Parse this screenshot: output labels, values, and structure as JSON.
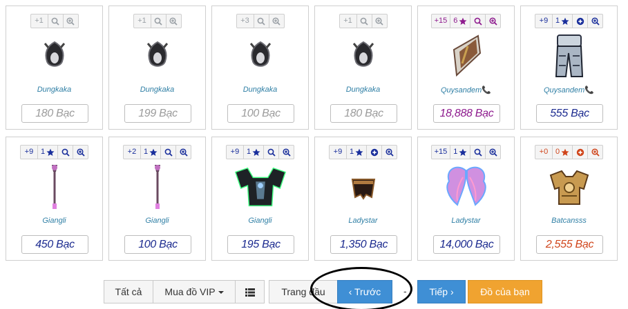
{
  "items": [
    {
      "level": "+1",
      "seller": "Dungkaka",
      "price": "180 Bạc",
      "theme": "dim",
      "icons": [
        "search-icon",
        "zoom-in-icon"
      ],
      "art": "ring-icon"
    },
    {
      "level": "+1",
      "seller": "Dungkaka",
      "price": "199 Bạc",
      "theme": "dim",
      "icons": [
        "search-icon",
        "zoom-in-icon"
      ],
      "art": "ring-icon"
    },
    {
      "level": "+3",
      "seller": "Dungkaka",
      "price": "100 Bạc",
      "theme": "dim",
      "icons": [
        "search-icon",
        "zoom-in-icon"
      ],
      "art": "ring-icon"
    },
    {
      "level": "+1",
      "seller": "Dungkaka",
      "price": "180 Bạc",
      "theme": "dim",
      "icons": [
        "search-icon",
        "zoom-in-icon"
      ],
      "art": "ring-icon"
    },
    {
      "level": "+15",
      "count": "6",
      "seller": "Quysandem",
      "phone": "📞",
      "price": "18,888 Bạc",
      "theme": "purple",
      "icons": [
        "star-icon",
        "search-icon",
        "zoom-in-icon"
      ],
      "art": "shield-icon"
    },
    {
      "level": "+9",
      "count": "1",
      "seller": "Quysandem",
      "phone": "📞",
      "price": "555 Bạc",
      "theme": "blue",
      "icons": [
        "star-icon",
        "plus-circle-icon",
        "zoom-in-icon"
      ],
      "art": "armor-pants-icon"
    },
    {
      "level": "+9",
      "count": "1",
      "seller": "Giangli",
      "price": "450 Bạc",
      "theme": "blue",
      "icons": [
        "star-icon",
        "search-icon",
        "zoom-in-icon"
      ],
      "art": "staff-icon"
    },
    {
      "level": "+2",
      "count": "1",
      "seller": "Giangli",
      "price": "100 Bạc",
      "theme": "blue",
      "icons": [
        "star-icon",
        "search-icon",
        "zoom-in-icon"
      ],
      "art": "staff-icon"
    },
    {
      "level": "+9",
      "count": "1",
      "seller": "Giangli",
      "price": "195 Bạc",
      "theme": "blue",
      "icons": [
        "star-icon",
        "search-icon",
        "zoom-in-icon"
      ],
      "art": "dark-armor-icon"
    },
    {
      "level": "+9",
      "count": "1",
      "seller": "Ladystar",
      "price": "1,350 Bạc",
      "theme": "blue",
      "icons": [
        "star-icon",
        "plus-circle-icon",
        "zoom-in-icon"
      ],
      "art": "gloves-icon"
    },
    {
      "level": "+15",
      "count": "1",
      "seller": "Ladystar",
      "price": "14,000 Bạc",
      "theme": "blue",
      "icons": [
        "star-icon",
        "search-icon",
        "zoom-in-icon"
      ],
      "art": "wings-icon"
    },
    {
      "level": "+0",
      "count": "0",
      "seller": "Batcansss",
      "price": "2,555 Bạc",
      "theme": "red",
      "icons": [
        "star-icon",
        "plus-circle-icon",
        "zoom-in-icon"
      ],
      "art": "gold-armor-icon"
    }
  ],
  "pager": {
    "all_label": "Tất cả",
    "vip_label": "Mua đồ VIP",
    "list_icon": "list-icon",
    "first_label": "Trang đầu",
    "prev_label": "‹ Trước",
    "separator": "-",
    "next_label": "Tiếp ›",
    "mine_label": "Đồ của bạn"
  },
  "colors": {
    "primary": "#3f8fd5",
    "orange": "#f0a330",
    "seller": "#2f7fa5",
    "price_blue": "#1b2a8f",
    "price_purple": "#8e1b8e",
    "price_red": "#d0451b",
    "price_dim": "#9b9b9b"
  }
}
